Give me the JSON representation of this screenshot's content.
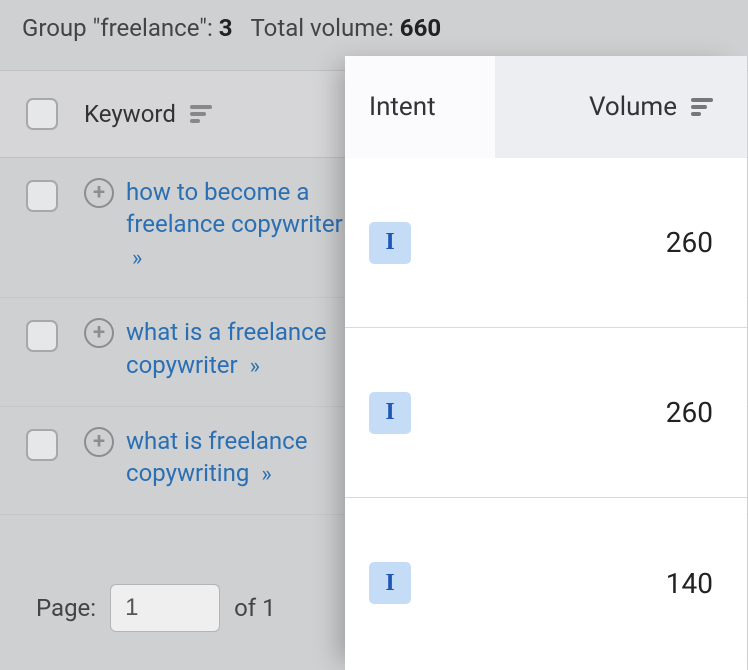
{
  "summary": {
    "group_label": "Group \"freelance\":",
    "group_count": "3",
    "total_label": "Total volume:",
    "total_value": "660"
  },
  "headers": {
    "keyword": "Keyword",
    "intent": "Intent",
    "volume": "Volume"
  },
  "rows": [
    {
      "keyword": "how to become a freelance copywriter",
      "intent": "I",
      "volume": "260"
    },
    {
      "keyword": "what is a freelance copywriter",
      "intent": "I",
      "volume": "260"
    },
    {
      "keyword": "what is freelance copywriting",
      "intent": "I",
      "volume": "140"
    }
  ],
  "pagination": {
    "label": "Page:",
    "current": "1",
    "of_label": "of 1"
  }
}
